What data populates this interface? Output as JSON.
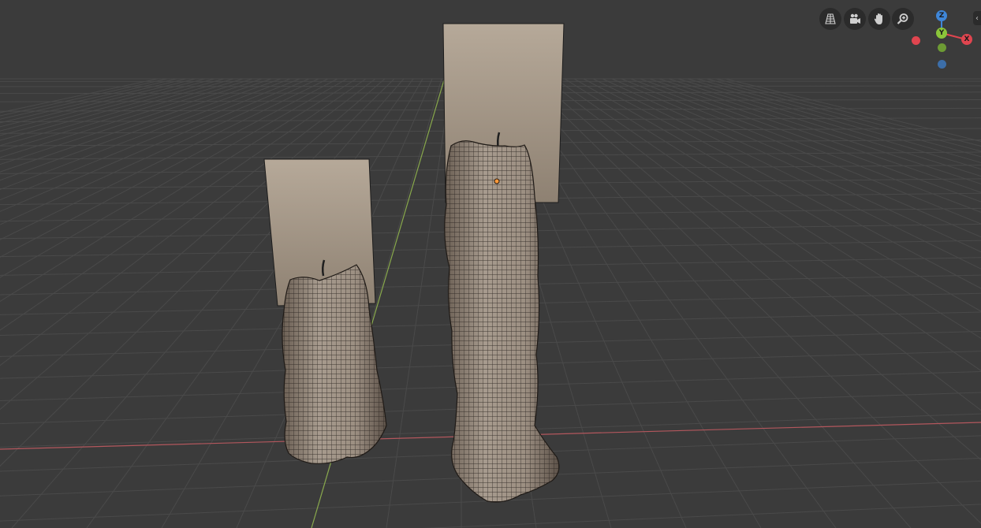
{
  "viewport": {
    "background": "#3b3b3b",
    "grid_color": "#4a4a4a",
    "x_axis_color": "#b3575d",
    "y_axis_color": "#88a84c"
  },
  "navigation": {
    "buttons": [
      {
        "name": "toggle-camera-view-grid-icon"
      },
      {
        "name": "camera-view-icon"
      },
      {
        "name": "pan-hand-icon"
      },
      {
        "name": "zoom-magnifier-icon"
      }
    ]
  },
  "gizmo": {
    "z_label": "Z",
    "y_label": "Y",
    "x_label": "X",
    "colors": {
      "x": "#e0454f",
      "y": "#8ac53a",
      "z": "#3f86d8",
      "neg_x": "#e0454f",
      "neg_y": "#6d9b34",
      "neg_z": "#3c6ea8"
    }
  },
  "objects": {
    "small_candle": "candle-small",
    "tall_candle": "candle-tall",
    "plane_left": "reference-plane-left",
    "plane_right": "reference-plane-right"
  },
  "edge_tab_glyph": "‹"
}
